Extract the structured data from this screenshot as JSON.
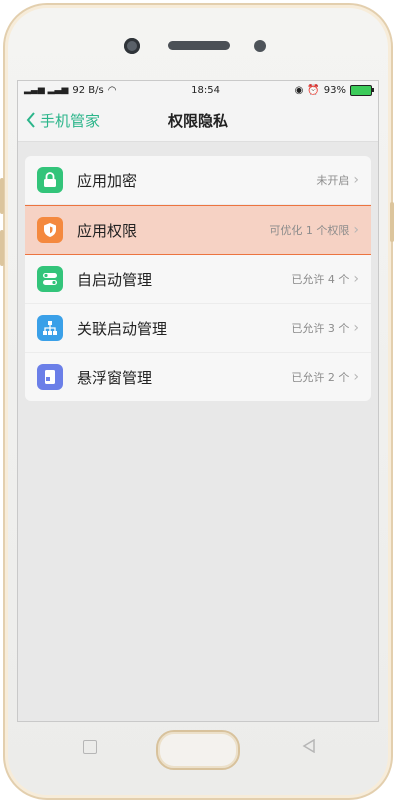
{
  "status": {
    "signal": "₂̸↑l ₂̸↑l",
    "speed": "92 B/s",
    "time": "18:54",
    "battery": "93%"
  },
  "nav": {
    "back_label": "手机管家",
    "title": "权限隐私"
  },
  "items": [
    {
      "label": "应用加密",
      "value": "未开启",
      "icon": "lock-icon",
      "color": "#33c47a"
    },
    {
      "label": "应用权限",
      "value": "可优化 1 个权限",
      "icon": "shield-icon",
      "color": "#f4893f"
    },
    {
      "label": "自启动管理",
      "value": "已允许 4 个",
      "icon": "toggle-icon",
      "color": "#33c47a"
    },
    {
      "label": "关联启动管理",
      "value": "已允许 3 个",
      "icon": "tree-icon",
      "color": "#3aa0e8"
    },
    {
      "label": "悬浮窗管理",
      "value": "已允许 2 个",
      "icon": "window-icon",
      "color": "#6b7fe8"
    }
  ]
}
